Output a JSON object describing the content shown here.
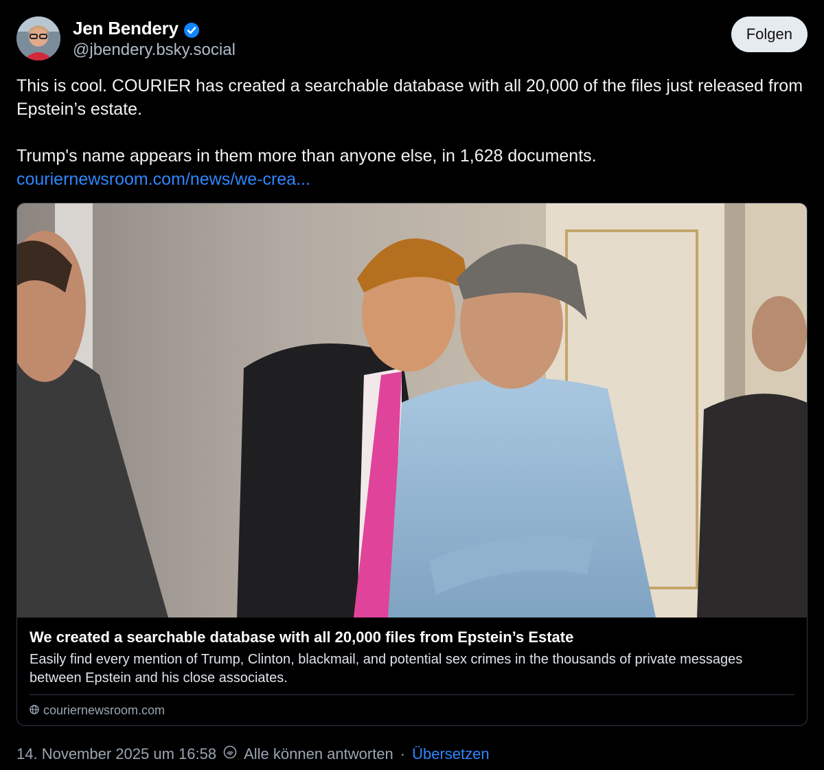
{
  "author": {
    "name": "Jen Bendery",
    "handle": "@jbendery.bsky.social"
  },
  "follow_label": "Folgen",
  "post": {
    "text_line1": "This is cool. COURIER has created a searchable database with all 20,000 of the files just released from Epstein’s estate.",
    "text_line2": "Trump's name appears in them more than anyone else, in 1,628 documents.",
    "link_text": "couriernewsroom.com/news/we-crea..."
  },
  "card": {
    "title": "We created a searchable database with all 20,000 files from Epstein’s Estate",
    "description": "Easily find every mention of Trump, Clinton, blackmail, and potential sex crimes in the thousands of private messages between Epstein and his close associates.",
    "domain": "couriernewsroom.com"
  },
  "footer": {
    "timestamp": "14. November 2025 um 16:58",
    "reply_setting": "Alle können antworten",
    "separator": "·",
    "translate": "Übersetzen"
  },
  "colors": {
    "background": "#000000",
    "link": "#2f86ff",
    "verified": "#1185fe"
  },
  "icons": [
    "verified-badge-icon",
    "globe-icon",
    "reply-setting-icon"
  ]
}
